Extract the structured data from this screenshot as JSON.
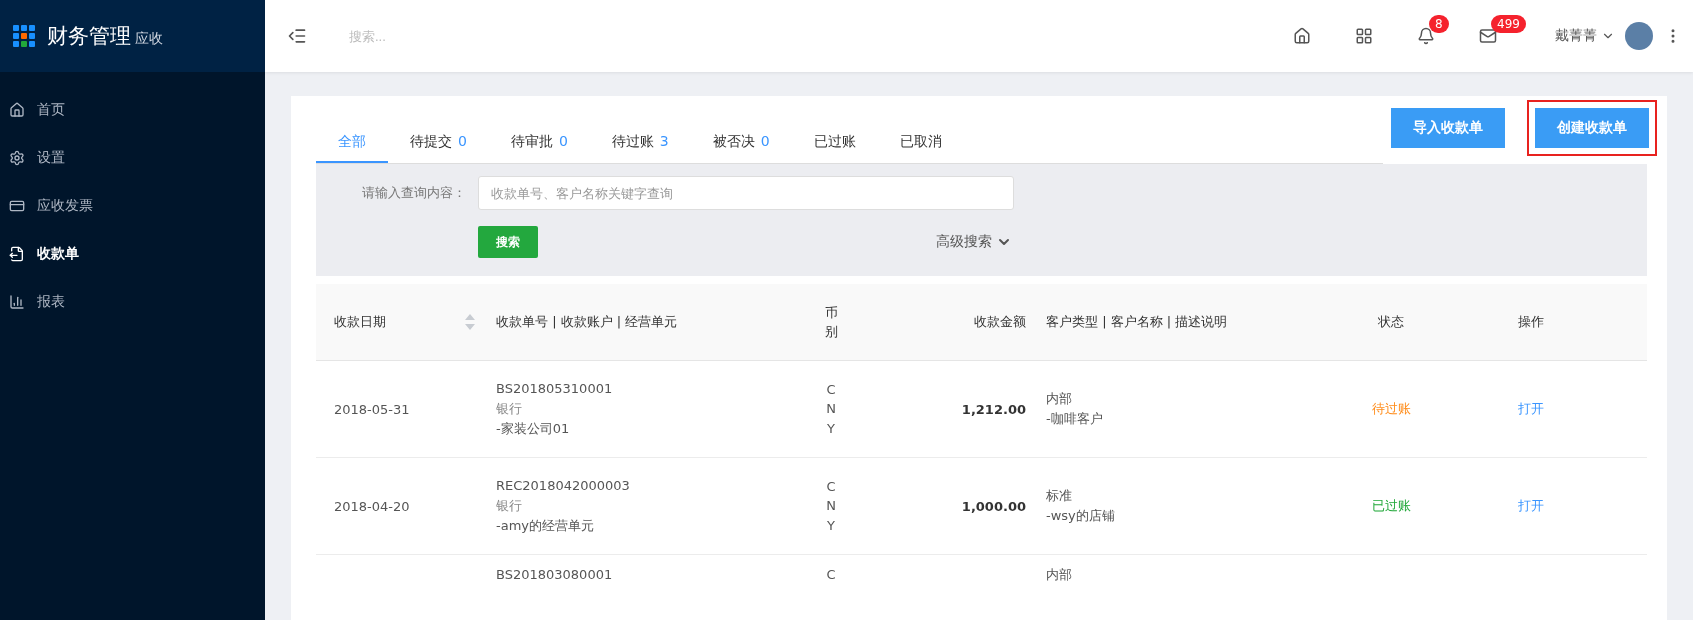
{
  "sidebar": {
    "brand": "财务管理",
    "module": "应收",
    "items": [
      {
        "label": "首页",
        "selected": false
      },
      {
        "label": "设置",
        "selected": false
      },
      {
        "label": "应收发票",
        "selected": false
      },
      {
        "label": "收款单",
        "selected": true
      },
      {
        "label": "报表",
        "selected": false
      }
    ]
  },
  "header": {
    "search_placeholder": "搜索...",
    "notifications": "8",
    "messages": "499",
    "user": "戴菁菁"
  },
  "tabs": [
    {
      "label": "全部",
      "selected": true
    },
    {
      "label": "待提交",
      "count": "0",
      "selected": false
    },
    {
      "label": "待审批",
      "count": "0",
      "selected": false
    },
    {
      "label": "待过账",
      "count": "3",
      "selected": false
    },
    {
      "label": "被否决",
      "count": "0",
      "selected": false
    },
    {
      "label": "已过账",
      "selected": false
    },
    {
      "label": "已取消",
      "selected": false
    }
  ],
  "actions": [
    {
      "label": "导入收款单",
      "highlighted": false
    },
    {
      "label": "创建收款单",
      "highlighted": true
    }
  ],
  "search": {
    "label": "请输入查询内容：",
    "placeholder": "收款单号、客户名称关键字查询",
    "button": "搜索",
    "advanced": "高级搜索"
  },
  "table": {
    "columns": [
      "收款日期",
      "收款单号 | 收款账户 | 经营单元",
      "币别",
      "收款金额",
      "客户类型 | 客户名称 | 描述说明",
      "状态",
      "操作"
    ],
    "rows": [
      {
        "date": "2018-05-31",
        "number": "BS201805310001",
        "account": "银行",
        "unit": "-家装公司01",
        "currency": "CNY",
        "amount": "1,212.00",
        "customer_type": "内部",
        "customer": "-咖啡客户",
        "status": "待过账",
        "color": "#ff8c1a",
        "action": "打开"
      },
      {
        "date": "2018-04-20",
        "number": "REC2018042000003",
        "account": "银行",
        "unit": "-amy的经营单元",
        "currency": "CNY",
        "amount": "1,000.00",
        "customer_type": "标准",
        "customer": "-wsy的店铺",
        "status": "已过账",
        "color": "#22a83a",
        "action": "打开"
      },
      {
        "number": "BS201803080001",
        "currency": "C",
        "customer_type": "内部"
      }
    ]
  }
}
